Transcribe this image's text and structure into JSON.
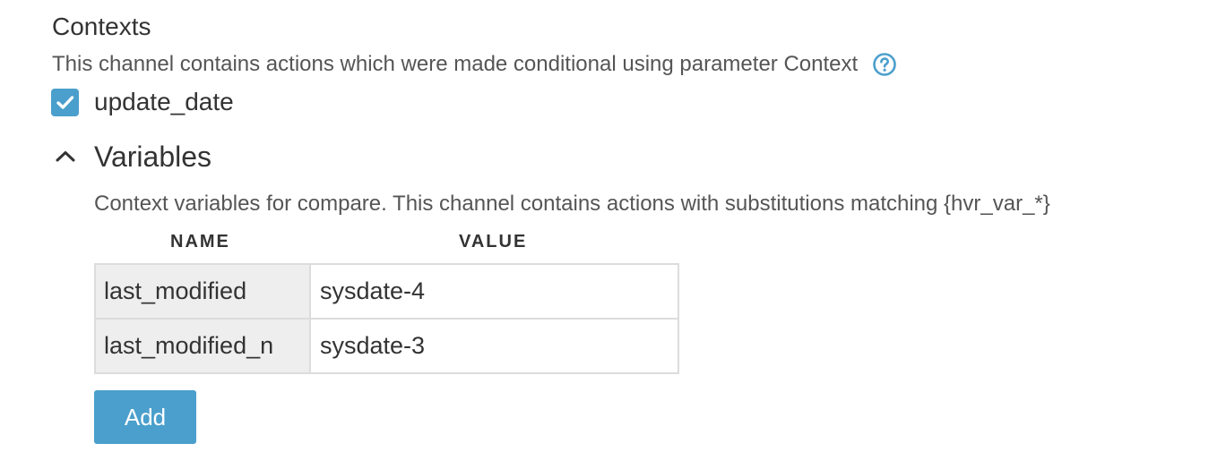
{
  "colors": {
    "accent": "#4a9fcc",
    "checkbox_fill": "#4a9fcc",
    "button_fill": "#4a9fcc"
  },
  "contexts": {
    "title": "Contexts",
    "description": "This channel contains actions which were made conditional using parameter Context",
    "help_icon": "question-circle-icon",
    "items": [
      {
        "label": "update_date",
        "checked": true
      }
    ]
  },
  "variables": {
    "label": "Variables",
    "expanded": true,
    "toggle_icon": "chevron-up-icon",
    "description": "Context variables for compare. This channel contains actions with substitutions matching {hvr_var_*}",
    "columns": [
      "NAME",
      "VALUE"
    ],
    "rows": [
      {
        "name": "last_modified",
        "value": "sysdate-4"
      },
      {
        "name": "last_modified_n",
        "value": "sysdate-3"
      }
    ],
    "add_label": "Add"
  }
}
